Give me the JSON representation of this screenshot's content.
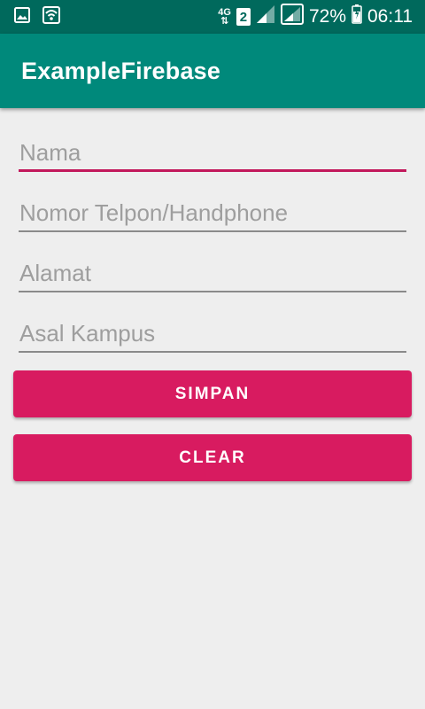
{
  "status_bar": {
    "network_type": "4G",
    "sim_slot": "2",
    "battery_percent": "72%",
    "time": "06:11",
    "icons": [
      "image-notification-icon",
      "wifi-icon",
      "signal-icon",
      "battery-charging-icon"
    ]
  },
  "app_bar": {
    "title": "ExampleFirebase",
    "color": "#00897b"
  },
  "form": {
    "fields": [
      {
        "placeholder": "Nama",
        "value": "",
        "focused": true
      },
      {
        "placeholder": "Nomor Telpon/Handphone",
        "value": ""
      },
      {
        "placeholder": "Alamat",
        "value": ""
      },
      {
        "placeholder": "Asal Kampus",
        "value": ""
      }
    ],
    "buttons": {
      "save_label": "SIMPAN",
      "clear_label": "CLEAR",
      "color": "#d81b60"
    }
  }
}
